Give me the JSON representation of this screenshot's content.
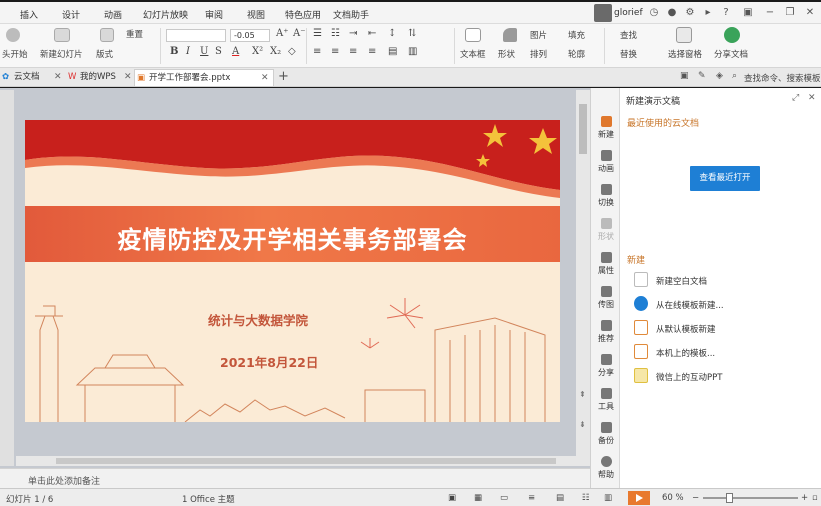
{
  "menu": {
    "items": [
      "插入",
      "设计",
      "动画",
      "幻灯片放映",
      "审阅",
      "视图",
      "特色应用",
      "文档助手"
    ],
    "username": "glorief"
  },
  "ribbon": {
    "play_from_start": "头开始",
    "new_slide": "新建幻灯片",
    "layout": "版式",
    "font_size": "-0.05",
    "textbox": "文本框",
    "shape": "形状",
    "picture": "图片",
    "fill": "填充",
    "arrange": "排列",
    "outline": "轮廓",
    "find": "查找",
    "replace": "替换",
    "select_pane": "选择窗格",
    "share_doc": "分享文档",
    "reset": "重置",
    "ask": "查找命令、搜索模板"
  },
  "tabs": [
    {
      "label": "云文档"
    },
    {
      "label": "我的WPS"
    },
    {
      "label": "开学工作部署会.pptx"
    }
  ],
  "slide": {
    "title": "疫情防控及开学相关事务部署会",
    "department": "统计与大数据学院",
    "date": "2021年8月22日"
  },
  "notes_placeholder": "单击此处添加备注",
  "sidebar": [
    {
      "label": "新建",
      "icon": "new-icon"
    },
    {
      "label": "动画",
      "icon": "animation-icon"
    },
    {
      "label": "切换",
      "icon": "transition-icon"
    },
    {
      "label": "形状",
      "icon": "shape-icon"
    },
    {
      "label": "属性",
      "icon": "property-icon"
    },
    {
      "label": "传图",
      "icon": "upload-image-icon"
    },
    {
      "label": "推荐",
      "icon": "recommend-icon"
    },
    {
      "label": "分享",
      "icon": "share-icon"
    },
    {
      "label": "工具",
      "icon": "tools-icon"
    },
    {
      "label": "备份",
      "icon": "backup-icon"
    },
    {
      "label": "帮助",
      "icon": "help-icon"
    }
  ],
  "panel": {
    "title": "新建演示文稿",
    "recent_heading": "最近使用的云文档",
    "view_recent": "查看最近打开",
    "new_heading": "新建",
    "items": [
      {
        "label": "新建空白文档",
        "color": "#d8d8d8"
      },
      {
        "label": "从在线模板新建...",
        "color": "#1e7fd5"
      },
      {
        "label": "从默认模板新建",
        "color": "#e08a3a"
      },
      {
        "label": "本机上的模板...",
        "color": "#e08a3a"
      },
      {
        "label": "微信上的互动PPT",
        "color": "#f0c030"
      }
    ]
  },
  "status": {
    "page": "1 / 6",
    "theme": "1 Office 主题",
    "zoom": "60 %",
    "zoom_level": 0.25
  },
  "colors": {
    "accent": "#1e7fd5",
    "banner": "#e9673f",
    "slide_bg": "#fbebd6",
    "play": "#e8792e"
  }
}
